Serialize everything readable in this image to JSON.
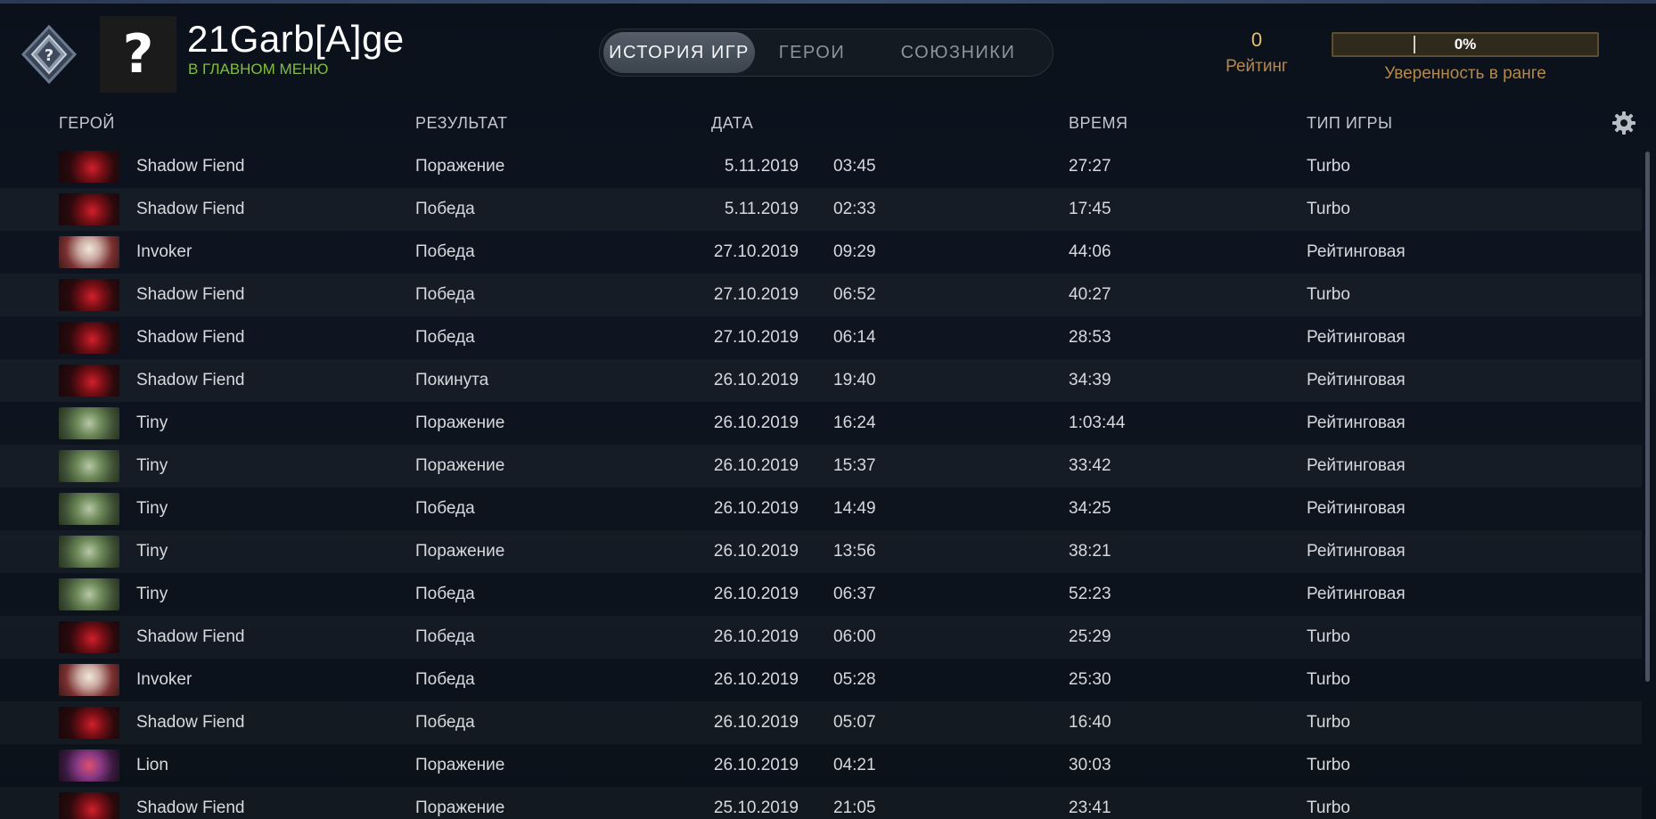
{
  "player": {
    "avatar_placeholder": "?",
    "name": "21Garb[A]ge",
    "status": "В ГЛАВНОМ МЕНЮ"
  },
  "tabs": [
    {
      "label": "ИСТОРИЯ ИГР",
      "active": true
    },
    {
      "label": "ГЕРОИ",
      "active": false
    },
    {
      "label": "СОЮЗНИКИ",
      "active": false
    }
  ],
  "rating": {
    "value": "0",
    "label": "Рейтинг"
  },
  "confidence": {
    "percent": "0%",
    "label": "Уверенность в ранге"
  },
  "columns": {
    "hero": "ГЕРОЙ",
    "result": "РЕЗУЛЬТАТ",
    "date": "ДАТА",
    "duration": "ВРЕМЯ",
    "game_type": "ТИП ИГРЫ"
  },
  "colors": {
    "loss": "#e04f3a",
    "win": "#8dc44e",
    "abandon": "#f07c2b",
    "status_green": "#7fbf3a",
    "rating_gold": "#e3c26a"
  },
  "matches": [
    {
      "hero": "Shadow Fiend",
      "portrait": "sf",
      "result": "Поражение",
      "result_kind": "loss",
      "date": "5.11.2019",
      "time": "03:45",
      "duration": "27:27",
      "type": "Turbo"
    },
    {
      "hero": "Shadow Fiend",
      "portrait": "sf",
      "result": "Победа",
      "result_kind": "win",
      "date": "5.11.2019",
      "time": "02:33",
      "duration": "17:45",
      "type": "Turbo"
    },
    {
      "hero": "Invoker",
      "portrait": "inv",
      "result": "Победа",
      "result_kind": "win",
      "date": "27.10.2019",
      "time": "09:29",
      "duration": "44:06",
      "type": "Рейтинговая"
    },
    {
      "hero": "Shadow Fiend",
      "portrait": "sf",
      "result": "Победа",
      "result_kind": "win",
      "date": "27.10.2019",
      "time": "06:52",
      "duration": "40:27",
      "type": "Turbo"
    },
    {
      "hero": "Shadow Fiend",
      "portrait": "sf",
      "result": "Победа",
      "result_kind": "win",
      "date": "27.10.2019",
      "time": "06:14",
      "duration": "28:53",
      "type": "Рейтинговая"
    },
    {
      "hero": "Shadow Fiend",
      "portrait": "sf",
      "result": "Покинута",
      "result_kind": "left",
      "date": "26.10.2019",
      "time": "19:40",
      "duration": "34:39",
      "type": "Рейтинговая"
    },
    {
      "hero": "Tiny",
      "portrait": "tiny",
      "result": "Поражение",
      "result_kind": "loss",
      "date": "26.10.2019",
      "time": "16:24",
      "duration": "1:03:44",
      "type": "Рейтинговая"
    },
    {
      "hero": "Tiny",
      "portrait": "tiny",
      "result": "Поражение",
      "result_kind": "loss",
      "date": "26.10.2019",
      "time": "15:37",
      "duration": "33:42",
      "type": "Рейтинговая"
    },
    {
      "hero": "Tiny",
      "portrait": "tiny",
      "result": "Победа",
      "result_kind": "win",
      "date": "26.10.2019",
      "time": "14:49",
      "duration": "34:25",
      "type": "Рейтинговая"
    },
    {
      "hero": "Tiny",
      "portrait": "tiny",
      "result": "Поражение",
      "result_kind": "loss",
      "date": "26.10.2019",
      "time": "13:56",
      "duration": "38:21",
      "type": "Рейтинговая"
    },
    {
      "hero": "Tiny",
      "portrait": "tiny",
      "result": "Победа",
      "result_kind": "win",
      "date": "26.10.2019",
      "time": "06:37",
      "duration": "52:23",
      "type": "Рейтинговая"
    },
    {
      "hero": "Shadow Fiend",
      "portrait": "sf",
      "result": "Победа",
      "result_kind": "win",
      "date": "26.10.2019",
      "time": "06:00",
      "duration": "25:29",
      "type": "Turbo"
    },
    {
      "hero": "Invoker",
      "portrait": "inv",
      "result": "Победа",
      "result_kind": "win",
      "date": "26.10.2019",
      "time": "05:28",
      "duration": "25:30",
      "type": "Turbo"
    },
    {
      "hero": "Shadow Fiend",
      "portrait": "sf",
      "result": "Победа",
      "result_kind": "win",
      "date": "26.10.2019",
      "time": "05:07",
      "duration": "16:40",
      "type": "Turbo"
    },
    {
      "hero": "Lion",
      "portrait": "lion",
      "result": "Поражение",
      "result_kind": "loss",
      "date": "26.10.2019",
      "time": "04:21",
      "duration": "30:03",
      "type": "Turbo"
    },
    {
      "hero": "Shadow Fiend",
      "portrait": "sf",
      "result": "Поражение",
      "result_kind": "loss",
      "date": "25.10.2019",
      "time": "21:05",
      "duration": "23:41",
      "type": "Turbo"
    }
  ]
}
